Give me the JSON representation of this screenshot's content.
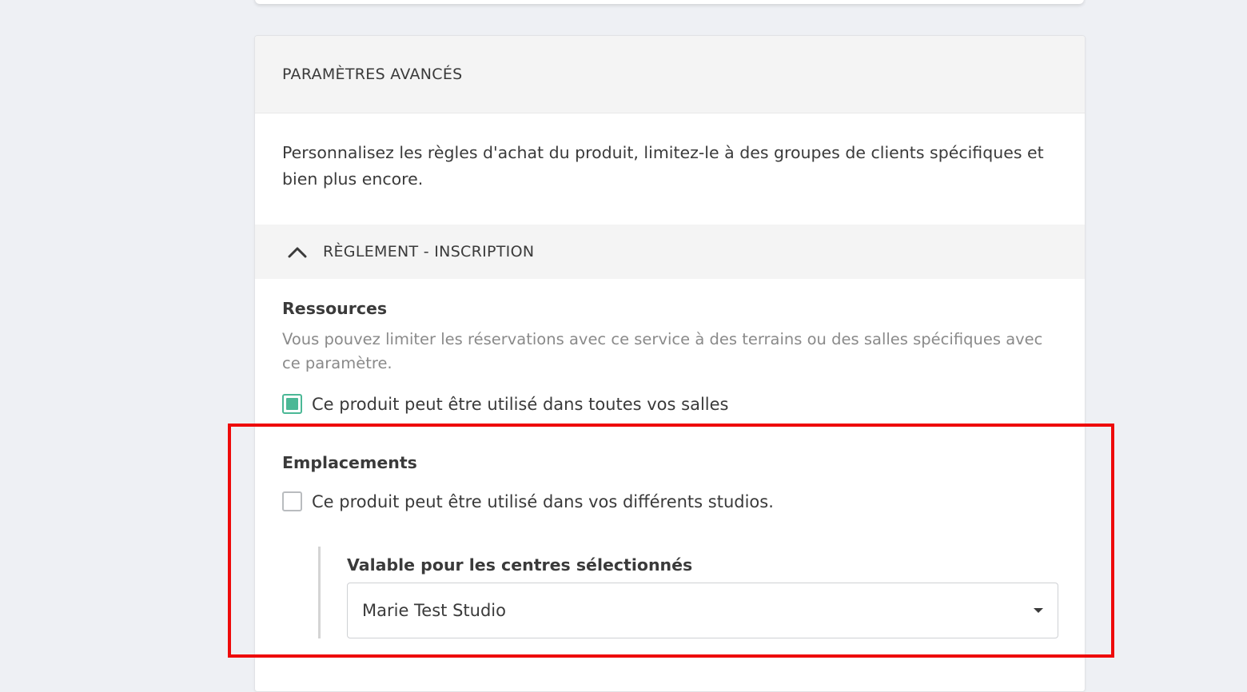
{
  "card": {
    "header_title": "PARAMÈTRES AVANCÉS",
    "intro_text": "Personnalisez les règles d'achat du produit, limitez-le à des groupes de clients spécifiques et bien plus encore."
  },
  "accordion": {
    "title": "RÈGLEMENT - INSCRIPTION",
    "expanded": true,
    "icon": "chevron-up-icon"
  },
  "ressources": {
    "title": "Ressources",
    "help_text": "Vous pouvez limiter les réservations avec ce service à des terrains ou des salles spécifiques avec ce paramètre.",
    "checkbox_label": "Ce produit peut être utilisé dans toutes vos salles",
    "checked": true
  },
  "emplacements": {
    "title": "Emplacements",
    "checkbox_label": "Ce produit peut être utilisé dans vos différents studios.",
    "checked": false,
    "select_label": "Valable pour les centres sélectionnés",
    "select_value": "Marie Test Studio"
  },
  "colors": {
    "accent": "#4bb896",
    "highlight": "#ee0a0a",
    "background": "#eef0f4"
  }
}
